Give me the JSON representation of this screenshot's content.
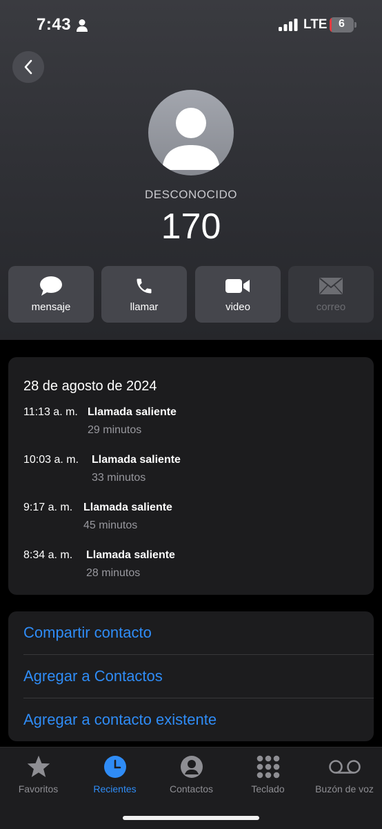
{
  "status_bar": {
    "time": "7:43",
    "network": "LTE",
    "battery_level": "6",
    "battery_fraction": 0.06
  },
  "contact": {
    "label": "DESCONOCIDO",
    "number": "170"
  },
  "actions": [
    {
      "label": "mensaje",
      "icon": "message-icon",
      "enabled": true
    },
    {
      "label": "llamar",
      "icon": "phone-icon",
      "enabled": true
    },
    {
      "label": "video",
      "icon": "video-icon",
      "enabled": true
    },
    {
      "label": "correo",
      "icon": "mail-icon",
      "enabled": false
    }
  ],
  "history": {
    "date": "28 de agosto de 2024",
    "calls": [
      {
        "time": "11:13 a. m.",
        "type": "Llamada saliente",
        "duration": "29 minutos"
      },
      {
        "time": "10:03 a. m.",
        "type": "Llamada saliente",
        "duration": "33 minutos"
      },
      {
        "time": "9:17 a. m.",
        "type": "Llamada saliente",
        "duration": "45 minutos"
      },
      {
        "time": "8:34 a. m.",
        "type": "Llamada saliente",
        "duration": "28 minutos"
      }
    ]
  },
  "options": [
    {
      "label": "Compartir contacto"
    },
    {
      "label": "Agregar a Contactos"
    },
    {
      "label": "Agregar a contacto existente"
    }
  ],
  "tabbar": {
    "tabs": [
      {
        "label": "Favoritos",
        "icon": "star-icon",
        "active": false
      },
      {
        "label": "Recientes",
        "icon": "clock-icon",
        "active": true
      },
      {
        "label": "Contactos",
        "icon": "person-circle-icon",
        "active": false
      },
      {
        "label": "Teclado",
        "icon": "keypad-icon",
        "active": false
      },
      {
        "label": "Buzón de voz",
        "icon": "voicemail-icon",
        "active": false
      }
    ]
  },
  "colors": {
    "accent": "#2f8cf6",
    "battery_low": "#e5393f",
    "card": "#1c1c1e",
    "action_button": "#45464c"
  }
}
